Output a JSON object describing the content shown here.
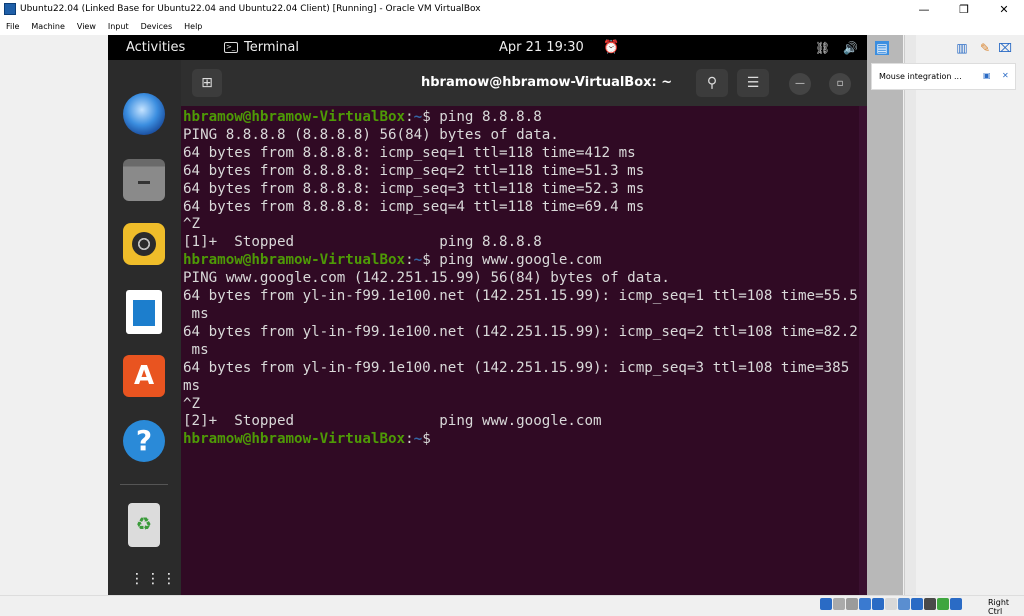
{
  "host_window": {
    "title": "Ubuntu22.04 (Linked Base for Ubuntu22.04 and Ubuntu22.04 Client) [Running] - Oracle VM VirtualBox",
    "menu": [
      "File",
      "Machine",
      "View",
      "Input",
      "Devices",
      "Help"
    ],
    "controls": {
      "minimize": "—",
      "restore": "❐",
      "close": "✕"
    }
  },
  "gnome_topbar": {
    "activities": "Activities",
    "app_name": "Terminal",
    "clock": "Apr 21  19:30",
    "alarm_icon": "⏰",
    "network_icon": "⛓",
    "volume_icon": "🔊"
  },
  "dock": {
    "items": [
      "thunderbird-icon",
      "files-icon",
      "rhythmbox-icon",
      "libreoffice-writer-icon",
      "ubuntu-software-icon",
      "help-icon",
      "trash-icon",
      "show-apps-icon"
    ],
    "software_glyph": "A",
    "help_glyph": "?",
    "trash_glyph": "♻",
    "apps_glyph": "⋮⋮⋮"
  },
  "terminal": {
    "title": "hbramow@hbramow-VirtualBox: ~",
    "new_tab_glyph": "⊞",
    "search_glyph": "⚲",
    "menu_glyph": "☰",
    "minimize_glyph": "—",
    "maximize_glyph": "▫",
    "lines": [
      {
        "user": "hbramow@hbramow-VirtualBox",
        "path": "~",
        "text": "$ ping 8.8.8.8"
      },
      {
        "text": "PING 8.8.8.8 (8.8.8.8) 56(84) bytes of data."
      },
      {
        "text": "64 bytes from 8.8.8.8: icmp_seq=1 ttl=118 time=412 ms"
      },
      {
        "text": "64 bytes from 8.8.8.8: icmp_seq=2 ttl=118 time=51.3 ms"
      },
      {
        "text": "64 bytes from 8.8.8.8: icmp_seq=3 ttl=118 time=52.3 ms"
      },
      {
        "text": "64 bytes from 8.8.8.8: icmp_seq=4 ttl=118 time=69.4 ms"
      },
      {
        "text": "^Z"
      },
      {
        "text": "[1]+  Stopped                 ping 8.8.8.8"
      },
      {
        "user": "hbramow@hbramow-VirtualBox",
        "path": "~",
        "text": "$ ping www.google.com"
      },
      {
        "text": "PING www.google.com (142.251.15.99) 56(84) bytes of data."
      },
      {
        "text": "64 bytes from yl-in-f99.1e100.net (142.251.15.99): icmp_seq=1 ttl=108 time=55.5"
      },
      {
        "text": " ms"
      },
      {
        "text": "64 bytes from yl-in-f99.1e100.net (142.251.15.99): icmp_seq=2 ttl=108 time=82.2"
      },
      {
        "text": " ms"
      },
      {
        "text": "64 bytes from yl-in-f99.1e100.net (142.251.15.99): icmp_seq=3 ttl=108 time=385"
      },
      {
        "text": "ms"
      },
      {
        "text": "^Z"
      },
      {
        "text": "[2]+  Stopped                 ping www.google.com"
      },
      {
        "user": "hbramow@hbramow-VirtualBox",
        "path": "~",
        "text": "$"
      }
    ]
  },
  "vbox_panel": {
    "notification": "Mouse integration ...",
    "toolbar_icons": [
      "vm-info-icon",
      "vm-settings-icon",
      "vm-close-icon"
    ]
  },
  "statusbar": {
    "host_key": "Right Ctrl"
  }
}
